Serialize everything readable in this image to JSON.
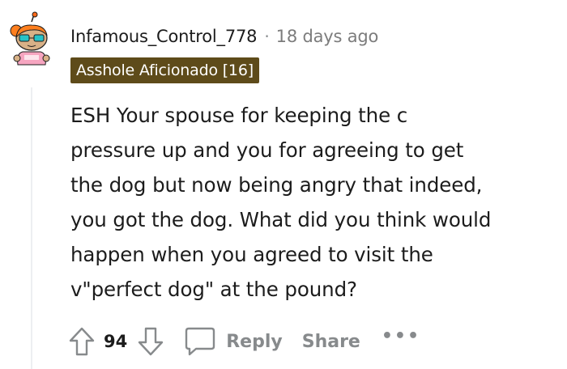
{
  "comment": {
    "author": "Infamous_Control_778",
    "separator": "·",
    "timestamp": "18 days ago",
    "flair": "Asshole Aficionado [16]",
    "body_lines": [
      "ESH Your spouse for keeping the c",
      "pressure up and you for agreeing to get",
      "the dog but now being angry that indeed,",
      "you got the dog. What did you think would",
      "happen when you agreed to visit the",
      "v\"perfect dog\" at the pound?"
    ],
    "vote_count": "94",
    "reply_label": "Reply",
    "share_label": "Share",
    "more_label": "•••"
  },
  "icons": {
    "avatar": "snoo-avatar-icon",
    "upvote": "upvote-arrow-icon",
    "downvote": "downvote-arrow-icon",
    "reply": "speech-bubble-icon",
    "more": "more-options-icon"
  },
  "colors": {
    "flair_bg": "#5e4b1a",
    "flair_text": "#ffffff",
    "muted": "#878a8c",
    "text": "#1c1c1c",
    "thread_line": "#edeff1"
  }
}
